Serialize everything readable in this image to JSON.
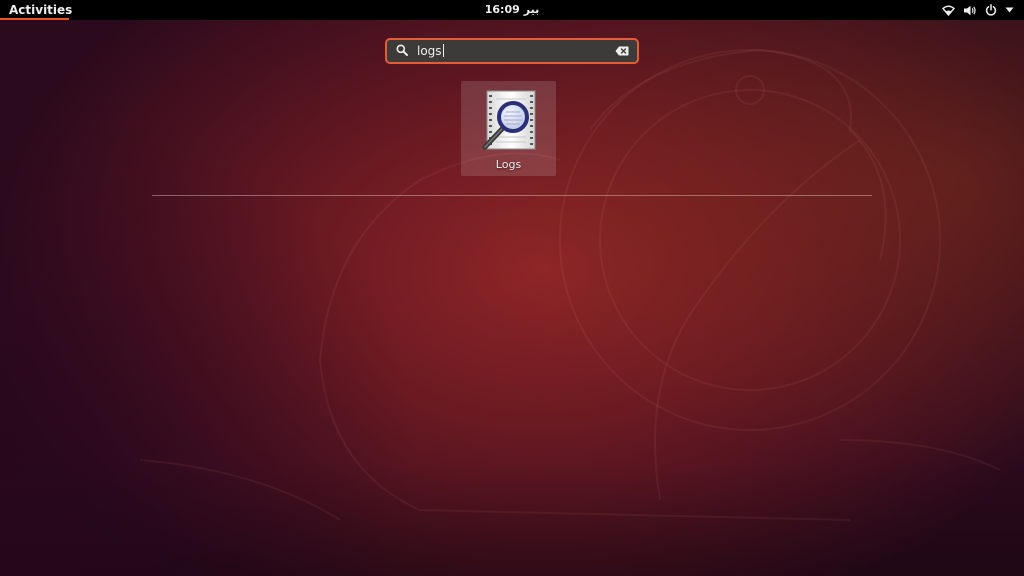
{
  "topbar": {
    "activities_label": "Activities",
    "clock_day": "بير",
    "clock_time": "16:09",
    "status_icons": [
      "wifi-icon",
      "volume-icon",
      "power-icon",
      "chevron-down-icon"
    ],
    "accent_color": "#e95420"
  },
  "search": {
    "value": "logs",
    "icon": "search-icon",
    "clear_icon": "clear-icon"
  },
  "results": [
    {
      "label": "Logs",
      "icon": "logs-app-icon"
    }
  ]
}
